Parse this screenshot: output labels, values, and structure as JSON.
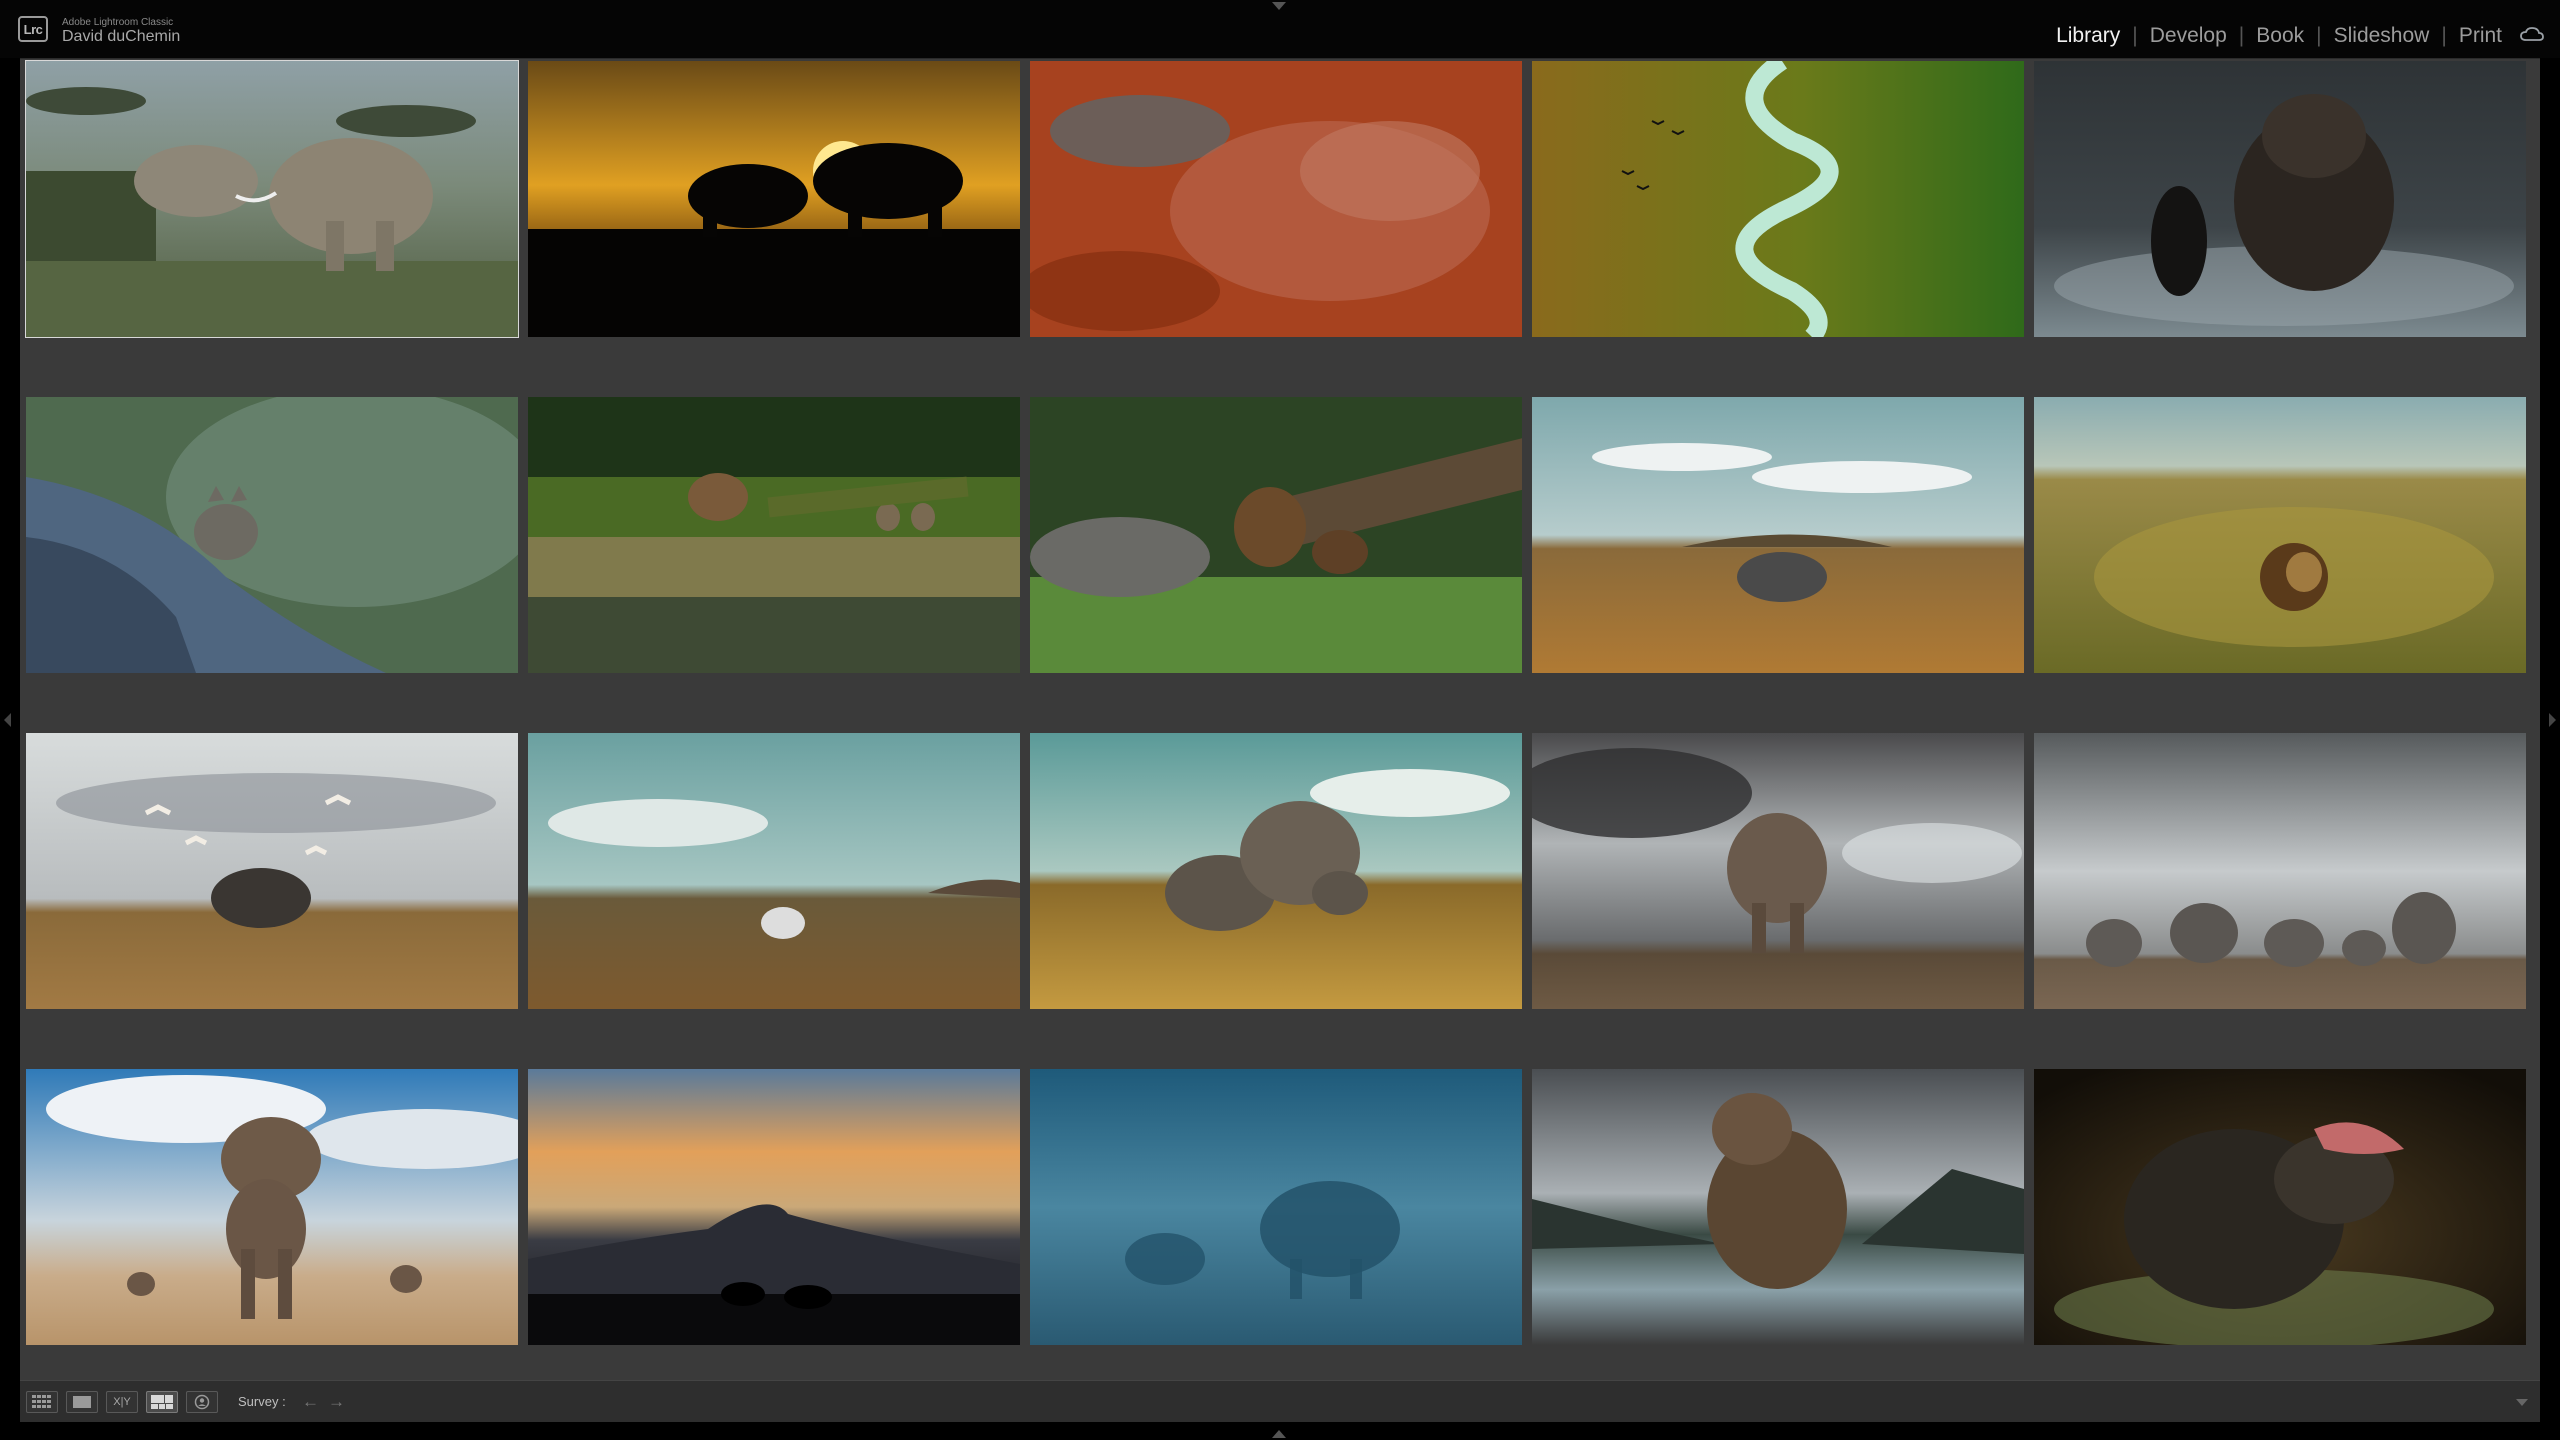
{
  "identity": {
    "badge": "Lrc",
    "app_name": "Adobe Lightroom Classic",
    "user_name": "David duChemin"
  },
  "modules": [
    {
      "label": "Library",
      "active": true
    },
    {
      "label": "Develop",
      "active": false
    },
    {
      "label": "Book",
      "active": false
    },
    {
      "label": "Slideshow",
      "active": false
    },
    {
      "label": "Print",
      "active": false
    }
  ],
  "grid": {
    "photos": [
      {
        "subject": "elephants",
        "scene": "savanna",
        "selected": true
      },
      {
        "subject": "rhinos",
        "scene": "sunset-silhouette",
        "selected": false
      },
      {
        "subject": "aerial",
        "scene": "red-water",
        "selected": false
      },
      {
        "subject": "aerial",
        "scene": "green-lake-birds",
        "selected": false
      },
      {
        "subject": "otter",
        "scene": "dark-water",
        "selected": false
      },
      {
        "subject": "wolf",
        "scene": "rock-forest",
        "selected": false
      },
      {
        "subject": "bears",
        "scene": "forest-river",
        "selected": false
      },
      {
        "subject": "bears",
        "scene": "forest-grass",
        "selected": false
      },
      {
        "subject": "rhino",
        "scene": "grassland-clouds",
        "selected": false
      },
      {
        "subject": "lion",
        "scene": "golden-grass",
        "selected": false
      },
      {
        "subject": "rhino-birds",
        "scene": "grassland-cloudy",
        "selected": false
      },
      {
        "subject": "zebra",
        "scene": "plains-teal",
        "selected": false
      },
      {
        "subject": "elephants",
        "scene": "grass-teal",
        "selected": false
      },
      {
        "subject": "rhino",
        "scene": "storm",
        "selected": false
      },
      {
        "subject": "rhinos",
        "scene": "cloudy-plain",
        "selected": false
      },
      {
        "subject": "elephant",
        "scene": "blue-sky-sand",
        "selected": false
      },
      {
        "subject": "rhinos",
        "scene": "mountain-dusk",
        "selected": false
      },
      {
        "subject": "elephants",
        "scene": "blue-fog",
        "selected": false
      },
      {
        "subject": "bear",
        "scene": "lake-mountains",
        "selected": false
      },
      {
        "subject": "bear",
        "scene": "water-salmon",
        "selected": false
      }
    ]
  },
  "toolbar": {
    "view_buttons": [
      {
        "icon": "grid-view-icon",
        "active": false
      },
      {
        "icon": "loupe-view-icon",
        "active": false
      },
      {
        "icon": "compare-view-icon",
        "label": "X|Y",
        "active": false
      },
      {
        "icon": "survey-view-icon",
        "active": true
      },
      {
        "icon": "people-view-icon",
        "active": false
      }
    ],
    "mode_label": "Survey :",
    "prev_arrow": "←",
    "next_arrow": "→"
  },
  "colors": {
    "background": "#3a3a3a",
    "toolbar": "#2e2e2e",
    "active_module": "#f2f2f2",
    "inactive_module": "#9c9c9c"
  }
}
